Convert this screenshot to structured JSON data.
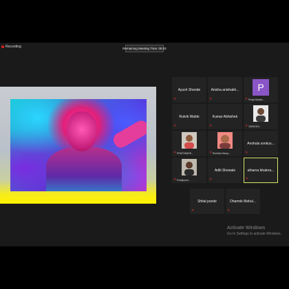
{
  "recording": {
    "label": "Recording"
  },
  "timer": {
    "label": "Remaining Meeting Time: 05:02"
  },
  "participants": [
    {
      "name": "Ayush Shende"
    },
    {
      "name": "Anisha anishakh..."
    },
    {
      "name": "",
      "caption": "Pooja Madan...",
      "avatar_letter": "P"
    },
    {
      "name": "Rutvik Walde"
    },
    {
      "name": "Kumar Abhishek"
    },
    {
      "name": "",
      "caption": "16001010..."
    },
    {
      "name": "",
      "caption": "PRATHMAYE..."
    },
    {
      "name": "",
      "caption": "Ruchika Hamp..."
    },
    {
      "name": "Anshula sonkus..."
    },
    {
      "name": "",
      "caption": "Pradipyom..."
    },
    {
      "name": "Aditi Shewale"
    },
    {
      "name": "atharva bhalera..."
    },
    {
      "name": "Shital punde"
    },
    {
      "name": "Dharmik Mahul..."
    }
  ],
  "watermark": {
    "title": "Activate Windows",
    "subtitle": "Go to Settings to activate Windows."
  }
}
